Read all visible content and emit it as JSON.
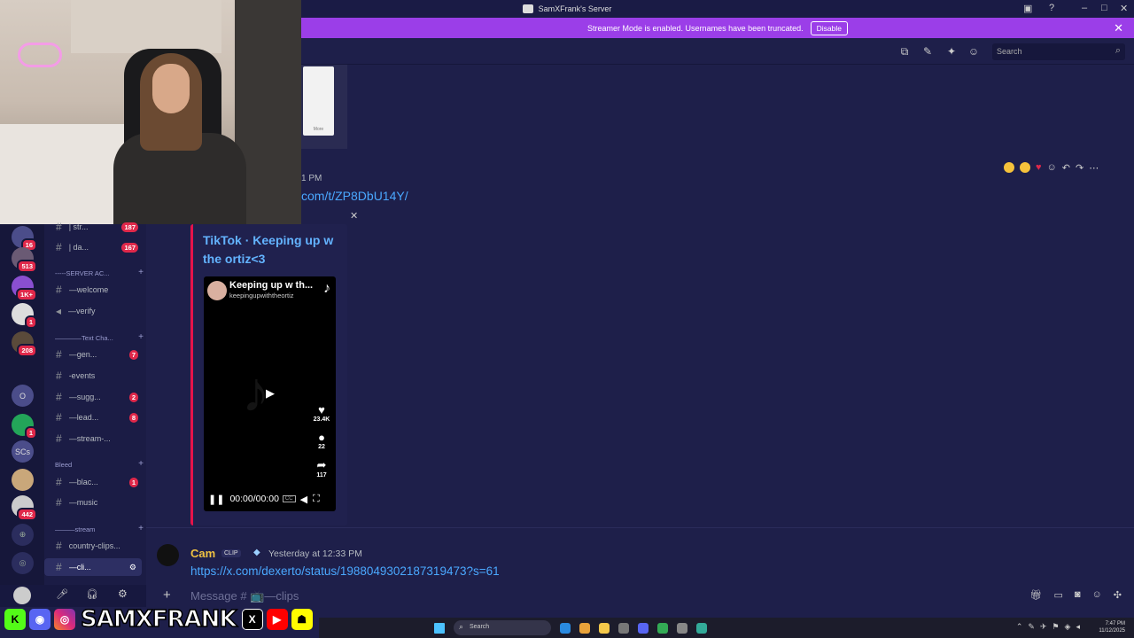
{
  "window": {
    "title": "SamXFrank's Server"
  },
  "banner": {
    "text": "Streamer Mode is enabled. Usernames have been truncated.",
    "button": "Disable"
  },
  "header": {
    "search_placeholder": "Search"
  },
  "server_list": [
    {
      "badge": "16"
    },
    {
      "badge": "513"
    },
    {
      "badge": "1K+"
    },
    {
      "badge": "1"
    },
    {
      "badge": "208"
    },
    {
      "label": "O"
    },
    {
      "badge": "1"
    },
    {
      "label": "SCs"
    },
    {
      "badge": ""
    },
    {
      "badge": "442"
    }
  ],
  "channels": {
    "items": [
      {
        "name": "| str...",
        "count": "187"
      },
      {
        "name": "| da...",
        "count": "167"
      },
      {
        "category": "-----SERVER AC..."
      },
      {
        "name": "—welcome",
        "count": ""
      },
      {
        "name": "—verify",
        "count": ""
      },
      {
        "category": "————Text Cha..."
      },
      {
        "name": "—gen...",
        "count": "7"
      },
      {
        "name": "-events",
        "count": ""
      },
      {
        "name": "—sugg...",
        "count": "2"
      },
      {
        "name": "—lead...",
        "count": "8"
      },
      {
        "name": "—stream-...",
        "count": ""
      },
      {
        "category": "Bleed"
      },
      {
        "name": "—blac...",
        "count": "1"
      },
      {
        "name": "—music",
        "count": ""
      },
      {
        "category": "———stream"
      },
      {
        "name": "country-clips...",
        "count": ""
      },
      {
        "name": "—cli...",
        "count": ""
      }
    ]
  },
  "messages": {
    "first": {
      "time_fragment": "1 PM",
      "link_fragment": "com/t/ZP8DbU14Y/",
      "thumb_caption": "More",
      "embed": {
        "title": "TikTok · Keeping up w the ortiz<3",
        "video_title": "Keeping up w th...",
        "video_user": "keepingupwiththeortiz",
        "likes": "23.4K",
        "comments": "22",
        "shares": "117",
        "time": "00:00/00:00"
      }
    },
    "second": {
      "author": "Cam",
      "tag": "CLIP",
      "timestamp": "Yesterday at 12:33 PM",
      "link": "https://x.com/dexerto/status/1988049302187319473?s=61"
    }
  },
  "composer": {
    "placeholder": "Message # 📺—clips"
  },
  "overlay": {
    "brand": "SAMXFRANK"
  },
  "taskbar": {
    "search": "Search",
    "time": "7:47 PM",
    "date": "11/12/2025"
  },
  "colors": {
    "accent": "#9b3ee8",
    "link": "#4aa8ff",
    "alert": "#e0284a",
    "embed_border": "#e5134a"
  }
}
